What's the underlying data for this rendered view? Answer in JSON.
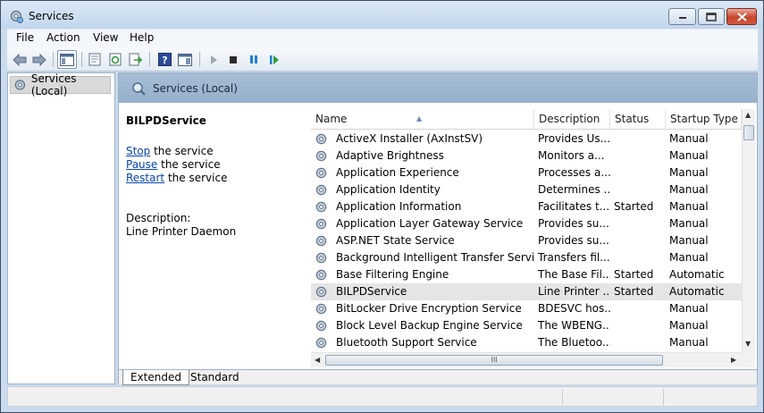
{
  "window": {
    "title": "Services"
  },
  "menu": [
    "File",
    "Action",
    "View",
    "Help"
  ],
  "toolbar_icons": [
    "back-icon",
    "forward-icon",
    "show-hide-console-tree-icon",
    "properties-icon",
    "refresh-icon",
    "export-list-icon",
    "help-icon",
    "show-hide-action-pane-icon",
    "start-service-icon",
    "stop-service-icon",
    "pause-service-icon",
    "restart-service-icon"
  ],
  "tree": {
    "root": "Services (Local)"
  },
  "content": {
    "header": "Services (Local)",
    "selected_service": "BILPDService",
    "actions": [
      {
        "link": "Stop",
        "rest": " the service"
      },
      {
        "link": "Pause",
        "rest": " the service"
      },
      {
        "link": "Restart",
        "rest": " the service"
      }
    ],
    "description_label": "Description:",
    "description": "Line Printer Daemon"
  },
  "columns": [
    "Name",
    "Description",
    "Status",
    "Startup Type"
  ],
  "services": [
    {
      "name": "ActiveX Installer (AxInstSV)",
      "description": "Provides Us...",
      "status": "",
      "startup": "Manual"
    },
    {
      "name": "Adaptive Brightness",
      "description": "Monitors a...",
      "status": "",
      "startup": "Manual"
    },
    {
      "name": "Application Experience",
      "description": "Processes a...",
      "status": "",
      "startup": "Manual"
    },
    {
      "name": "Application Identity",
      "description": "Determines ...",
      "status": "",
      "startup": "Manual"
    },
    {
      "name": "Application Information",
      "description": "Facilitates t...",
      "status": "Started",
      "startup": "Manual"
    },
    {
      "name": "Application Layer Gateway Service",
      "description": "Provides su...",
      "status": "",
      "startup": "Manual"
    },
    {
      "name": "ASP.NET State Service",
      "description": "Provides su...",
      "status": "",
      "startup": "Manual"
    },
    {
      "name": "Background Intelligent Transfer Service",
      "description": "Transfers fil...",
      "status": "",
      "startup": "Manual"
    },
    {
      "name": "Base Filtering Engine",
      "description": "The Base Fil...",
      "status": "Started",
      "startup": "Automatic"
    },
    {
      "name": "BILPDService",
      "description": "Line Printer ...",
      "status": "Started",
      "startup": "Automatic"
    },
    {
      "name": "BitLocker Drive Encryption Service",
      "description": "BDESVC hos...",
      "status": "",
      "startup": "Manual"
    },
    {
      "name": "Block Level Backup Engine Service",
      "description": "The WBENG...",
      "status": "",
      "startup": "Manual"
    },
    {
      "name": "Bluetooth Support Service",
      "description": "The Bluetoo...",
      "status": "",
      "startup": "Manual"
    }
  ],
  "selected_row": 9,
  "scroll_thumb_glyph": "III",
  "tabs": [
    "Extended",
    "Standard"
  ],
  "active_tab": "Extended"
}
